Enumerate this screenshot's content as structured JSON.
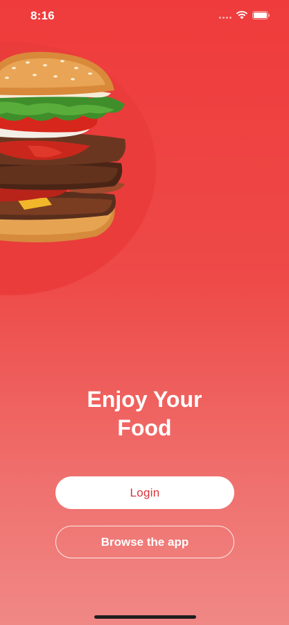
{
  "status_bar": {
    "time": "8:16",
    "wifi_icon": "wifi-icon",
    "battery_icon": "battery-icon"
  },
  "hero": {
    "image": "burger-image",
    "headline_line1": "Enjoy Your",
    "headline_line2": "Food"
  },
  "actions": {
    "login_label": "Login",
    "browse_label": "Browse the app"
  },
  "colors": {
    "background_top": "#ef3b3b",
    "background_bottom": "#f08886",
    "login_text": "#d9343a"
  }
}
